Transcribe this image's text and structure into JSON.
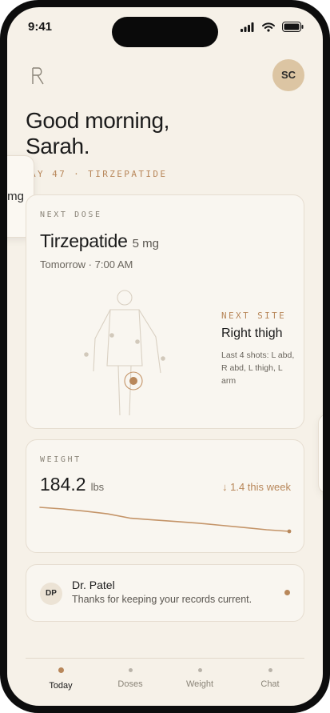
{
  "status_bar": {
    "time": "9:41"
  },
  "header": {
    "logo_letter": "R",
    "avatar_initials": "SC"
  },
  "greeting": {
    "line1": "Good morning,",
    "line2": "Sarah.",
    "day_line": "AY 47 · TIRZEPATIDE"
  },
  "side_cards": {
    "left_peek_text": "mg"
  },
  "next_dose": {
    "eyebrow": "NEXT DOSE",
    "medication": "Tirzepatide",
    "amount": "5 mg",
    "time": "Tomorrow · 7:00 AM",
    "site_eyebrow": "NEXT SITE",
    "site": "Right thigh",
    "history": "Last 4 shots: L abd, R abd, L thigh, L arm"
  },
  "weight": {
    "eyebrow": "WEIGHT",
    "value": "184.2",
    "unit": "lbs",
    "change": "↓ 1.4 this week",
    "trend": [
      188.6,
      188.3,
      187.9,
      187.4,
      186.6,
      186.3,
      186.0,
      185.7,
      185.3,
      184.9,
      184.5,
      184.2
    ]
  },
  "message": {
    "initials": "DP",
    "from": "Dr. Patel",
    "text": "Thanks for keeping your records current."
  },
  "tabs": [
    {
      "label": "Today",
      "active": true
    },
    {
      "label": "Doses",
      "active": false
    },
    {
      "label": "Weight",
      "active": false
    },
    {
      "label": "Chat",
      "active": false
    }
  ],
  "colors": {
    "background": "#f6f1e8",
    "card": "#f9f6f0",
    "accent": "#b8875a",
    "text": "#1b1b1b",
    "muted": "#8a8478"
  }
}
